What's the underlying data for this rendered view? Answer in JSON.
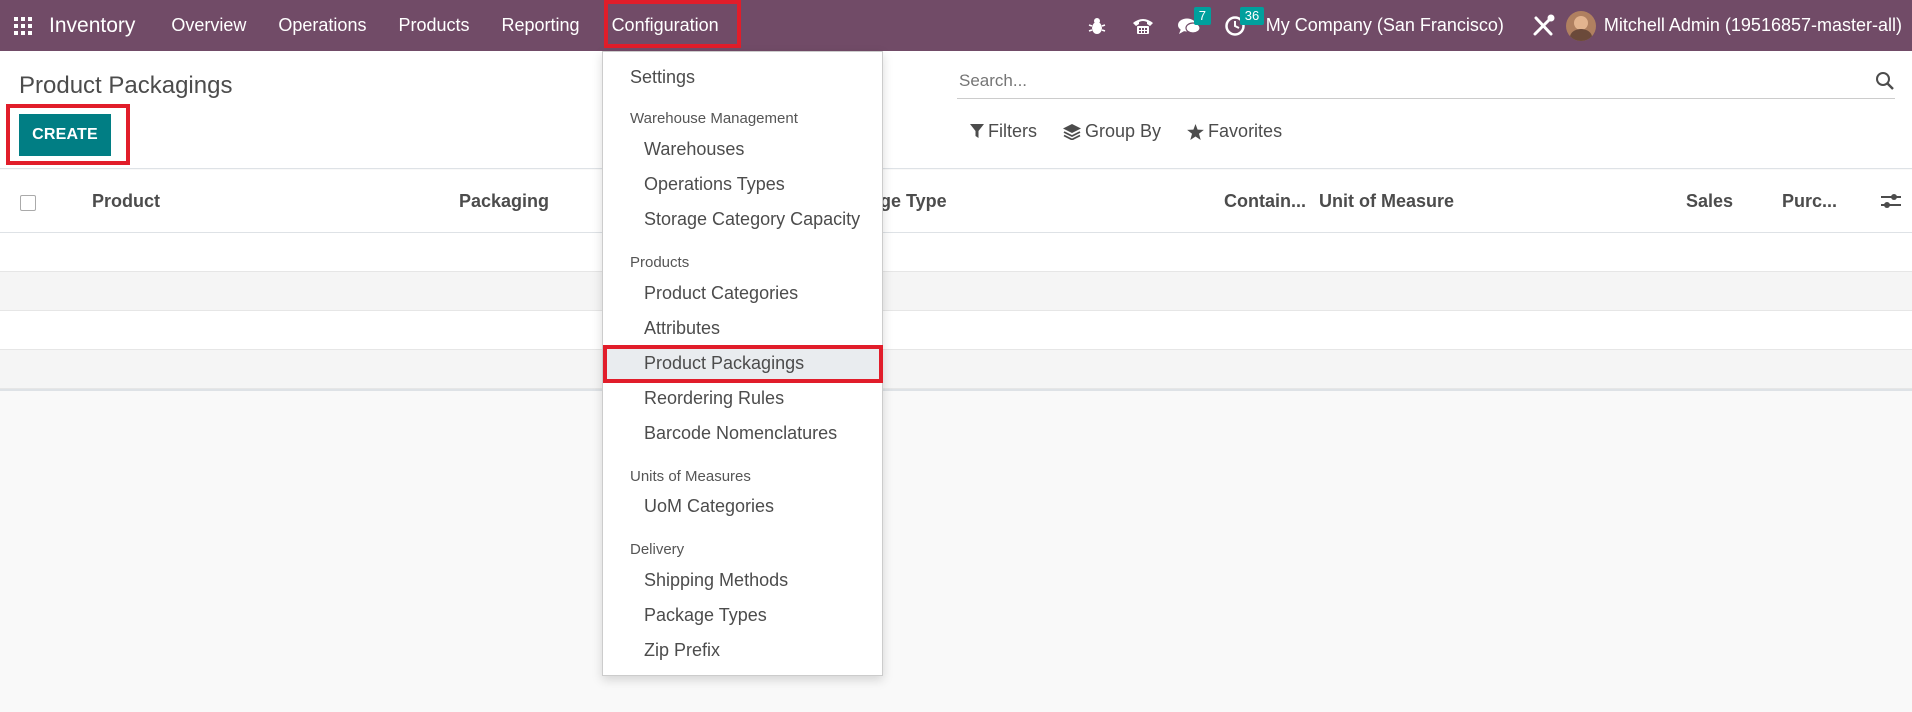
{
  "app": {
    "name": "Inventory"
  },
  "nav": {
    "items": [
      {
        "label": "Overview"
      },
      {
        "label": "Operations"
      },
      {
        "label": "Products"
      },
      {
        "label": "Reporting"
      },
      {
        "label": "Configuration"
      }
    ]
  },
  "systray": {
    "messages_count": "7",
    "activities_count": "36",
    "company": "My Company (San Francisco)",
    "user": "Mitchell Admin (19516857-master-all)"
  },
  "control": {
    "title": "Product Packagings",
    "create_label": "CREATE",
    "search_placeholder": "Search...",
    "filters_label": "Filters",
    "groupby_label": "Group By",
    "favorites_label": "Favorites"
  },
  "table": {
    "columns": [
      "Product",
      "Packaging",
      "ge Type",
      "Contain...",
      "Unit of Measure",
      "Sales",
      "Purc..."
    ]
  },
  "dropdown": {
    "settings": "Settings",
    "warehouse_header": "Warehouse Management",
    "warehouses": "Warehouses",
    "operations_types": "Operations Types",
    "storage_capacity": "Storage Category Capacity",
    "products_header": "Products",
    "product_categories": "Product Categories",
    "attributes": "Attributes",
    "product_packagings": "Product Packagings",
    "reordering_rules": "Reordering Rules",
    "barcode_nomenclatures": "Barcode Nomenclatures",
    "uom_header": "Units of Measures",
    "uom_categories": "UoM Categories",
    "delivery_header": "Delivery",
    "shipping_methods": "Shipping Methods",
    "package_types": "Package Types",
    "zip_prefix": "Zip Prefix"
  },
  "colors": {
    "navbar": "#714b67",
    "primary": "#017e84",
    "badge": "#00a09d",
    "highlight": "#e11d2a"
  },
  "icons": {
    "apps": "apps-grid-icon",
    "debug": "bug-icon",
    "voip": "phone-icon",
    "messages": "chat-icon",
    "activities": "clock-icon",
    "tools": "tools-icon",
    "search": "search-icon"
  }
}
